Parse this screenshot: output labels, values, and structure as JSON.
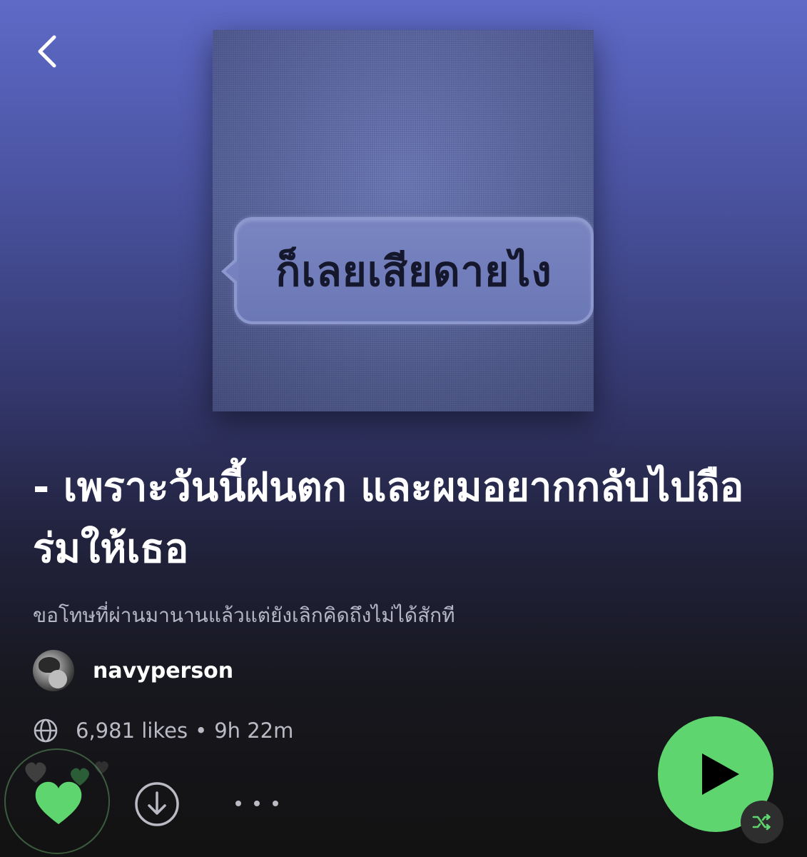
{
  "navigation": {
    "back_icon": "chevron-left-icon"
  },
  "cover": {
    "bubble_text": "ก็เลยเสียดายไง"
  },
  "playlist": {
    "title": "- เพราะวันนี้ฝนตก และผมอยากกลับไปถือร่มให้เธอ",
    "description": "ขอโทษที่ผ่านมานานแล้วแต่ยังเลิกคิดถึงไม่ได้สักที",
    "owner": "navyperson",
    "visibility_icon": "globe-icon",
    "likes": "6,981 likes",
    "separator": "•",
    "duration": "9h 22m"
  },
  "actions": {
    "like_icon": "heart-filled-icon",
    "liked": true,
    "download_icon": "download-circle-icon",
    "more_icon": "more-horizontal-icon",
    "play_icon": "play-icon",
    "shuffle_icon": "shuffle-icon"
  },
  "colors": {
    "accent": "#5fd56f",
    "background_top": "#5e6ac7",
    "background_bottom": "#121212",
    "secondary_text": "#b9bac4"
  }
}
